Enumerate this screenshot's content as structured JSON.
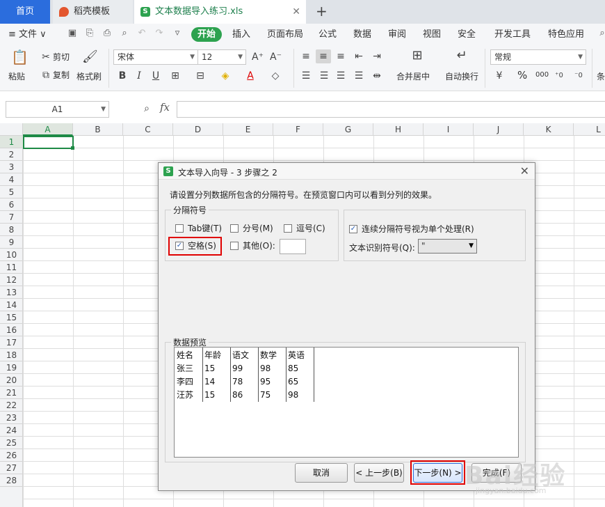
{
  "tabs": {
    "home": "首页",
    "daoke": "稻壳模板",
    "file": "文本数据导入练习.xls",
    "close": "✕",
    "add": "+"
  },
  "menu": {
    "file": "≡ 文件 ∨",
    "items": [
      "开始",
      "插入",
      "页面布局",
      "公式",
      "数据",
      "审阅",
      "视图",
      "安全",
      "开发工具",
      "特色应用"
    ]
  },
  "ribbon": {
    "paste": "粘贴",
    "cut": "剪切",
    "copy": "复制",
    "format_painter": "格式刷",
    "font_name": "宋体",
    "font_size": "12",
    "merge_center": "合并居中",
    "wrap_text": "自动换行",
    "number_format": "常规",
    "percent": "%",
    "thousands": "000",
    "right_edge": "条"
  },
  "formula_bar": {
    "name_box": "A1",
    "fx": "fx"
  },
  "grid": {
    "columns": [
      "A",
      "B",
      "C",
      "D",
      "E",
      "F",
      "G",
      "H",
      "I",
      "J",
      "K",
      "L"
    ],
    "rows": [
      "1",
      "2",
      "3",
      "4",
      "5",
      "6",
      "7",
      "8",
      "9",
      "10",
      "11",
      "12",
      "13",
      "14",
      "15",
      "16",
      "17",
      "18",
      "19",
      "20",
      "21",
      "22",
      "23",
      "24",
      "25",
      "26",
      "27",
      "28"
    ]
  },
  "dialog": {
    "title": "文本导入向导 - 3 步骤之 2",
    "instruction": "请设置分列数据所包含的分隔符号。在预览窗口内可以看到分列的效果。",
    "delimiters_group": "分隔符号",
    "tab": "Tab键(T)",
    "semicolon": "分号(M)",
    "comma": "逗号(C)",
    "space": "空格(S)",
    "other": "其他(O):",
    "consecutive": "连续分隔符号视为单个处理(R)",
    "qualifier_label": "文本识别符号(Q):",
    "qualifier_value": "\"",
    "preview_group": "数据预览",
    "preview_rows": [
      [
        "姓名",
        "年龄",
        "语文",
        "数学",
        "英语"
      ],
      [
        "张三",
        "15",
        "99",
        "98",
        "85"
      ],
      [
        "李四",
        "14",
        "78",
        "95",
        "65"
      ],
      [
        "汪苏",
        "15",
        "86",
        "75",
        "98"
      ]
    ],
    "cancel": "取消",
    "back": "< 上一步(B)",
    "next": "下一步(N) >",
    "finish": "完成(F)",
    "close": "✕"
  },
  "watermark": {
    "text": "Bai经验",
    "sub": "jingyan.baidu.com"
  }
}
